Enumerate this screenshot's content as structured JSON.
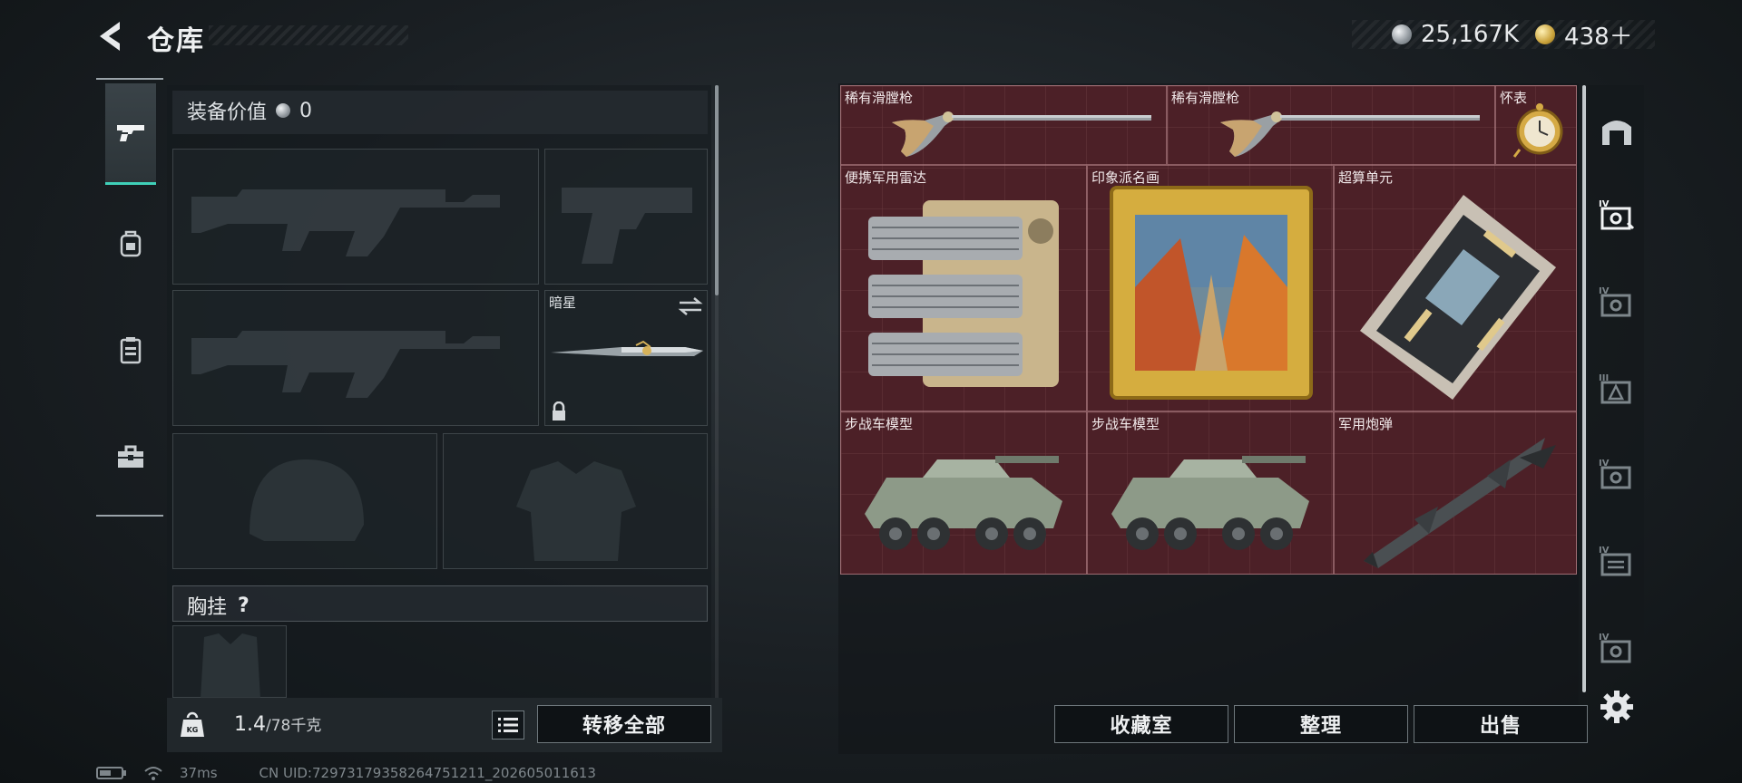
{
  "header": {
    "title": "仓库",
    "currencies": [
      {
        "icon": "silver-coin-icon",
        "value": "25,167K"
      },
      {
        "icon": "gold-coin-icon",
        "value": "438＋"
      }
    ]
  },
  "left_panel": {
    "categories": [
      "pistol-icon",
      "backpack-icon",
      "armor-vest-icon",
      "toolbox-icon"
    ],
    "equipment_value_label": "装备价值",
    "equipment_value": "0",
    "melee_slot_name": "暗星",
    "chest_rig_label": "胸挂",
    "chest_rig_help": "?",
    "weight_value": "1.4",
    "weight_limit": "/78千克",
    "transfer_all_label": "转移全部"
  },
  "storage": {
    "items": [
      {
        "name": "稀有滑膛枪",
        "icon": "musket-icon"
      },
      {
        "name": "稀有滑膛枪",
        "icon": "musket-icon"
      },
      {
        "name": "怀表",
        "icon": "pocket-watch-icon"
      },
      {
        "name": "便携军用雷达",
        "icon": "radar-icon"
      },
      {
        "name": "印象派名画",
        "icon": "painting-icon"
      },
      {
        "name": "超算单元",
        "icon": "computing-unit-icon"
      },
      {
        "name": "步战车模型",
        "icon": "ifv-model-icon"
      },
      {
        "name": "步战车模型",
        "icon": "ifv-model-icon"
      },
      {
        "name": "军用炮弹",
        "icon": "missile-icon"
      }
    ],
    "buttons": {
      "collection": "收藏室",
      "organize": "整理",
      "sell": "出售"
    }
  },
  "right_rail": {
    "tabs": [
      "IV",
      "IV",
      "III",
      "IV",
      "IV",
      "IV"
    ]
  },
  "status": {
    "ping": "37ms",
    "uid": "CN UID:7297317935826475121​1_202605011613"
  },
  "colors": {
    "accent": "#3fd0b8",
    "grid_bg": "#4b2026"
  }
}
